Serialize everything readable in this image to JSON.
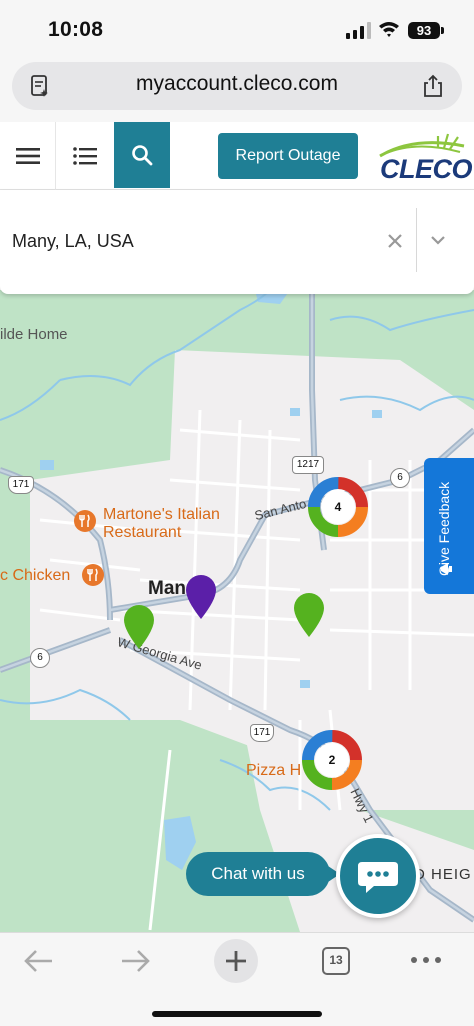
{
  "status_bar": {
    "time": "10:08",
    "battery": "93"
  },
  "browser": {
    "url": "myaccount.cleco.com",
    "tab_count": "13"
  },
  "header": {
    "report_button": "Report Outage",
    "logo_text": "CLECO"
  },
  "location": {
    "value": "Many, LA, USA"
  },
  "map": {
    "place_labels": {
      "top_left": "ilde Home",
      "town": "Man",
      "pizza": "Pizza H",
      "heights": "D HEIG"
    },
    "poi": {
      "restaurant_line1": "Martone's Italian",
      "restaurant_line2": "Restaurant",
      "chicken": "c Chicken"
    },
    "streets": {
      "san_antonio": "San Anto",
      "georgia": "W Georgia Ave",
      "hwy": "Hwy 1"
    },
    "route_shields": {
      "r171_left": "171",
      "r6_left": "6",
      "r1217": "1217",
      "r6_right": "6",
      "r171_bottom": "171"
    },
    "clusters": [
      {
        "count": "4"
      },
      {
        "count": "2"
      }
    ],
    "pins": [
      {
        "color": "#55b21f"
      },
      {
        "color": "#5b1fa8"
      },
      {
        "color": "#55b21f"
      }
    ]
  },
  "feedback": {
    "label": "Give Feedback"
  },
  "chat": {
    "label": "Chat with us"
  },
  "colors": {
    "accent": "#1f7f95",
    "feedback": "#1477d9",
    "outage_green": "#55b21f",
    "outage_purple": "#5b1fa8"
  }
}
